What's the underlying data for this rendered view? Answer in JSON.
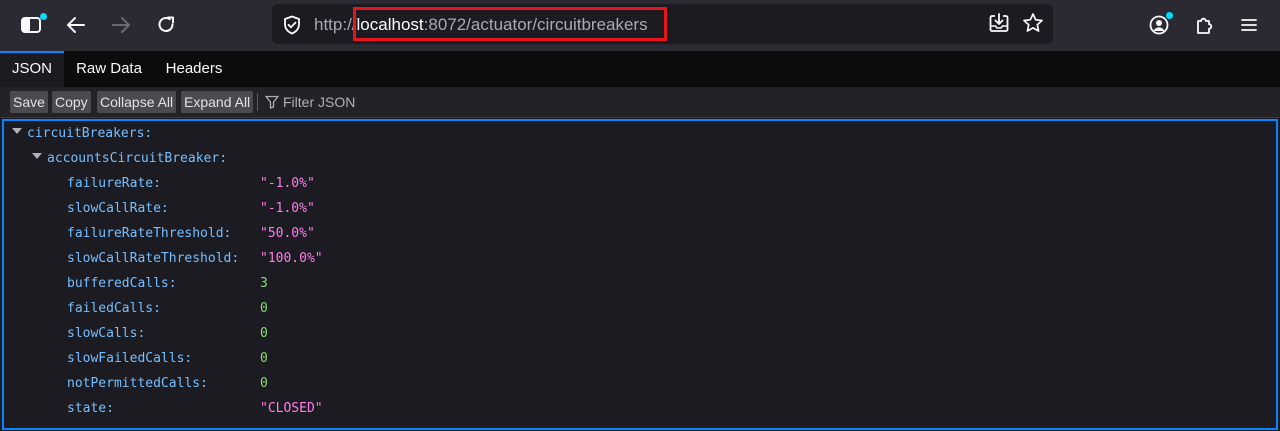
{
  "browser": {
    "url_scheme": "http://",
    "url_host": "localhost",
    "url_rest": ":8072/actuator/circuitbreakers"
  },
  "tabs": [
    {
      "label": "JSON",
      "active": true
    },
    {
      "label": "Raw Data",
      "active": false
    },
    {
      "label": "Headers",
      "active": false
    }
  ],
  "actions": {
    "save": "Save",
    "copy": "Copy",
    "collapse_all": "Collapse All",
    "expand_all": "Expand All",
    "filter_placeholder": "Filter JSON"
  },
  "json": {
    "root_key": "circuitBreakers",
    "breaker_key": "accountsCircuitBreaker",
    "fields": [
      {
        "key": "failureRate",
        "value": "\"-1.0%\"",
        "type": "string"
      },
      {
        "key": "slowCallRate",
        "value": "\"-1.0%\"",
        "type": "string"
      },
      {
        "key": "failureRateThreshold",
        "value": "\"50.0%\"",
        "type": "string"
      },
      {
        "key": "slowCallRateThreshold",
        "value": "\"100.0%\"",
        "type": "string"
      },
      {
        "key": "bufferedCalls",
        "value": "3",
        "type": "number"
      },
      {
        "key": "failedCalls",
        "value": "0",
        "type": "number"
      },
      {
        "key": "slowCalls",
        "value": "0",
        "type": "number"
      },
      {
        "key": "slowFailedCalls",
        "value": "0",
        "type": "number"
      },
      {
        "key": "notPermittedCalls",
        "value": "0",
        "type": "number"
      },
      {
        "key": "state",
        "value": "\"CLOSED\"",
        "type": "string"
      }
    ]
  },
  "colors": {
    "key": "#75bfff",
    "string": "#ff7de9",
    "number": "#86de74",
    "accent": "#0a84ff",
    "url_highlight": "#e8151c"
  },
  "icons": [
    "sidebar-icon",
    "back-icon",
    "forward-icon",
    "reload-icon",
    "shield-icon",
    "download-icon",
    "star-icon",
    "account-icon",
    "extensions-icon",
    "menu-icon",
    "filter-icon"
  ]
}
